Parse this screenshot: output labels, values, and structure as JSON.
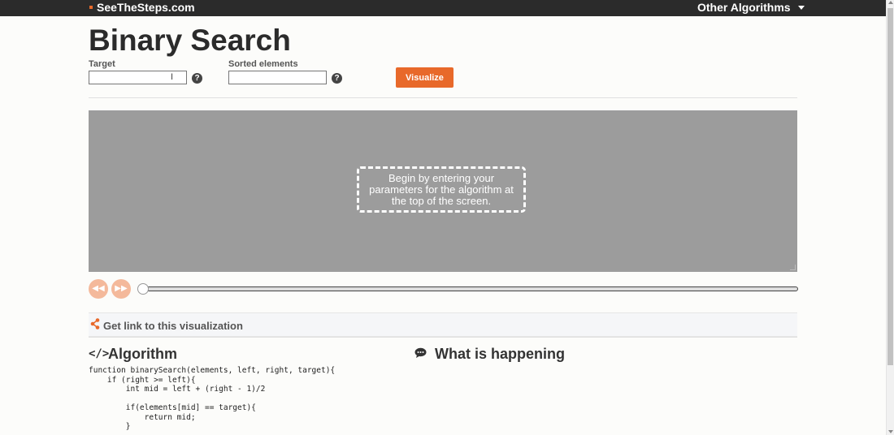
{
  "topbar": {
    "brand": "SeeTheSteps.com",
    "menu_label": "Other Algorithms"
  },
  "page": {
    "title": "Binary Search"
  },
  "inputs": {
    "target_label": "Target",
    "target_value": "",
    "elements_label": "Sorted elements",
    "elements_value": "",
    "help_glyph": "?"
  },
  "actions": {
    "visualize_label": "Visualize"
  },
  "stage": {
    "message": "Begin by entering your parameters for the algorithm at the top of the screen."
  },
  "playback": {
    "rewind_glyph": "◀◀",
    "forward_glyph": "▶▶",
    "progress": 0
  },
  "share": {
    "label": "Get link to this visualization"
  },
  "sections": {
    "algorithm_title": "Algorithm",
    "algorithm_icon": "</>",
    "happening_title": "What is happening"
  },
  "code": {
    "lines": [
      "function binarySearch(elements, left, right, target){",
      "    if (right >= left){",
      "        int mid = left + (right - 1)/2",
      "",
      "        if(elements[mid] == target){",
      "            return mid;",
      "        }"
    ]
  },
  "colors": {
    "accent": "#e8692a",
    "topbar": "#2b2b2b",
    "stage": "#9c9c9c"
  }
}
